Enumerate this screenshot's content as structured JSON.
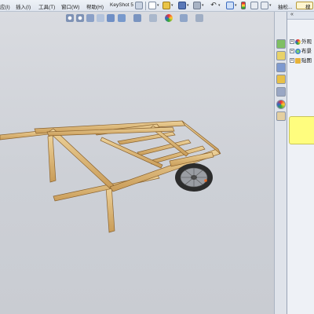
{
  "menubar": {
    "items": [
      {
        "label": "应(I)"
      },
      {
        "label": "插入(I)"
      },
      {
        "label": "工具(T)"
      },
      {
        "label": "窗口(W)"
      },
      {
        "label": "帮助(H)"
      },
      {
        "label": "KeyShot 5"
      }
    ],
    "right_label": "抽松...",
    "search_label": "搜"
  },
  "taskpane": {
    "collapse_glyph": "«",
    "tree": [
      {
        "label": "外观"
      },
      {
        "label": "布景"
      },
      {
        "label": "贴图"
      }
    ]
  },
  "colors": {
    "viewport_bg": "#cdd0d6",
    "wood": "#e2bd7e",
    "wood_dark": "#b88a4a",
    "tire": "#2c2c2c",
    "note_yellow": "#fffd7e"
  }
}
